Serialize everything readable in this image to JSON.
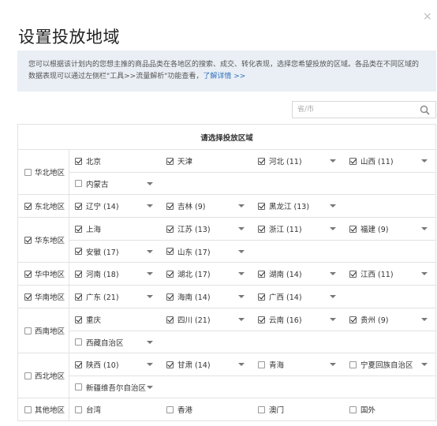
{
  "dialog": {
    "close_glyph": "×",
    "title": "设置投放地域"
  },
  "notice": {
    "text": "您可以根据该计划内的您想主推的商品品类在各地区的搜索、成交、转化表现，选择您希望投放的区域。各品类在不同区域的数据表现可以通过左侧栏\"工具>>流量解析\"功能查看，",
    "link": "了解详情 >>"
  },
  "search": {
    "placeholder": "省/市",
    "icon": "search-icon"
  },
  "table": {
    "header": "请选择投放区域",
    "regions": [
      {
        "name": "华北地区",
        "checked": false,
        "rows": [
          [
            {
              "name": "北京",
              "checked": true,
              "dropdown": false
            },
            {
              "name": "天津",
              "checked": true,
              "dropdown": false
            },
            {
              "name": "河北 (11)",
              "checked": true,
              "dropdown": true
            },
            {
              "name": "山西 (11)",
              "checked": true,
              "dropdown": true
            }
          ],
          [
            {
              "name": "内蒙古",
              "checked": false,
              "dropdown": true
            }
          ]
        ]
      },
      {
        "name": "东北地区",
        "checked": true,
        "rows": [
          [
            {
              "name": "辽宁 (14)",
              "checked": true,
              "dropdown": true
            },
            {
              "name": "吉林 (9)",
              "checked": true,
              "dropdown": true
            },
            {
              "name": "黑龙江 (13)",
              "checked": true,
              "dropdown": true
            }
          ]
        ]
      },
      {
        "name": "华东地区",
        "checked": true,
        "rows": [
          [
            {
              "name": "上海",
              "checked": true,
              "dropdown": false
            },
            {
              "name": "江苏 (13)",
              "checked": true,
              "dropdown": true
            },
            {
              "name": "浙江 (11)",
              "checked": true,
              "dropdown": true
            },
            {
              "name": "福建 (9)",
              "checked": true,
              "dropdown": true
            }
          ],
          [
            {
              "name": "安徽 (17)",
              "checked": true,
              "dropdown": true
            },
            {
              "name": "山东 (17)",
              "checked": true,
              "dropdown": true
            }
          ]
        ]
      },
      {
        "name": "华中地区",
        "checked": true,
        "rows": [
          [
            {
              "name": "河南 (18)",
              "checked": true,
              "dropdown": true
            },
            {
              "name": "湖北 (17)",
              "checked": true,
              "dropdown": true
            },
            {
              "name": "湖南 (14)",
              "checked": true,
              "dropdown": true
            },
            {
              "name": "江西 (11)",
              "checked": true,
              "dropdown": true
            }
          ]
        ]
      },
      {
        "name": "华南地区",
        "checked": true,
        "rows": [
          [
            {
              "name": "广东 (21)",
              "checked": true,
              "dropdown": true
            },
            {
              "name": "海南 (14)",
              "checked": true,
              "dropdown": true
            },
            {
              "name": "广西 (14)",
              "checked": true,
              "dropdown": true
            }
          ]
        ]
      },
      {
        "name": "西南地区",
        "checked": false,
        "rows": [
          [
            {
              "name": "重庆",
              "checked": true,
              "dropdown": false
            },
            {
              "name": "四川 (21)",
              "checked": true,
              "dropdown": true
            },
            {
              "name": "云南 (16)",
              "checked": true,
              "dropdown": true
            },
            {
              "name": "贵州 (9)",
              "checked": true,
              "dropdown": true
            }
          ],
          [
            {
              "name": "西藏自治区",
              "checked": false,
              "dropdown": true
            }
          ]
        ]
      },
      {
        "name": "西北地区",
        "checked": false,
        "rows": [
          [
            {
              "name": "陕西 (10)",
              "checked": true,
              "dropdown": true
            },
            {
              "name": "甘肃 (14)",
              "checked": true,
              "dropdown": true
            },
            {
              "name": "青海",
              "checked": false,
              "dropdown": true
            },
            {
              "name": "宁夏回族自治区",
              "checked": false,
              "dropdown": true
            }
          ],
          [
            {
              "name": "新疆维吾尔自治区",
              "checked": false,
              "dropdown": true
            }
          ]
        ]
      },
      {
        "name": "其他地区",
        "checked": false,
        "rows": [
          [
            {
              "name": "台湾",
              "checked": false,
              "dropdown": false
            },
            {
              "name": "香港",
              "checked": false,
              "dropdown": false
            },
            {
              "name": "澳门",
              "checked": false,
              "dropdown": false
            },
            {
              "name": "国外",
              "checked": false,
              "dropdown": false
            }
          ]
        ]
      }
    ]
  }
}
